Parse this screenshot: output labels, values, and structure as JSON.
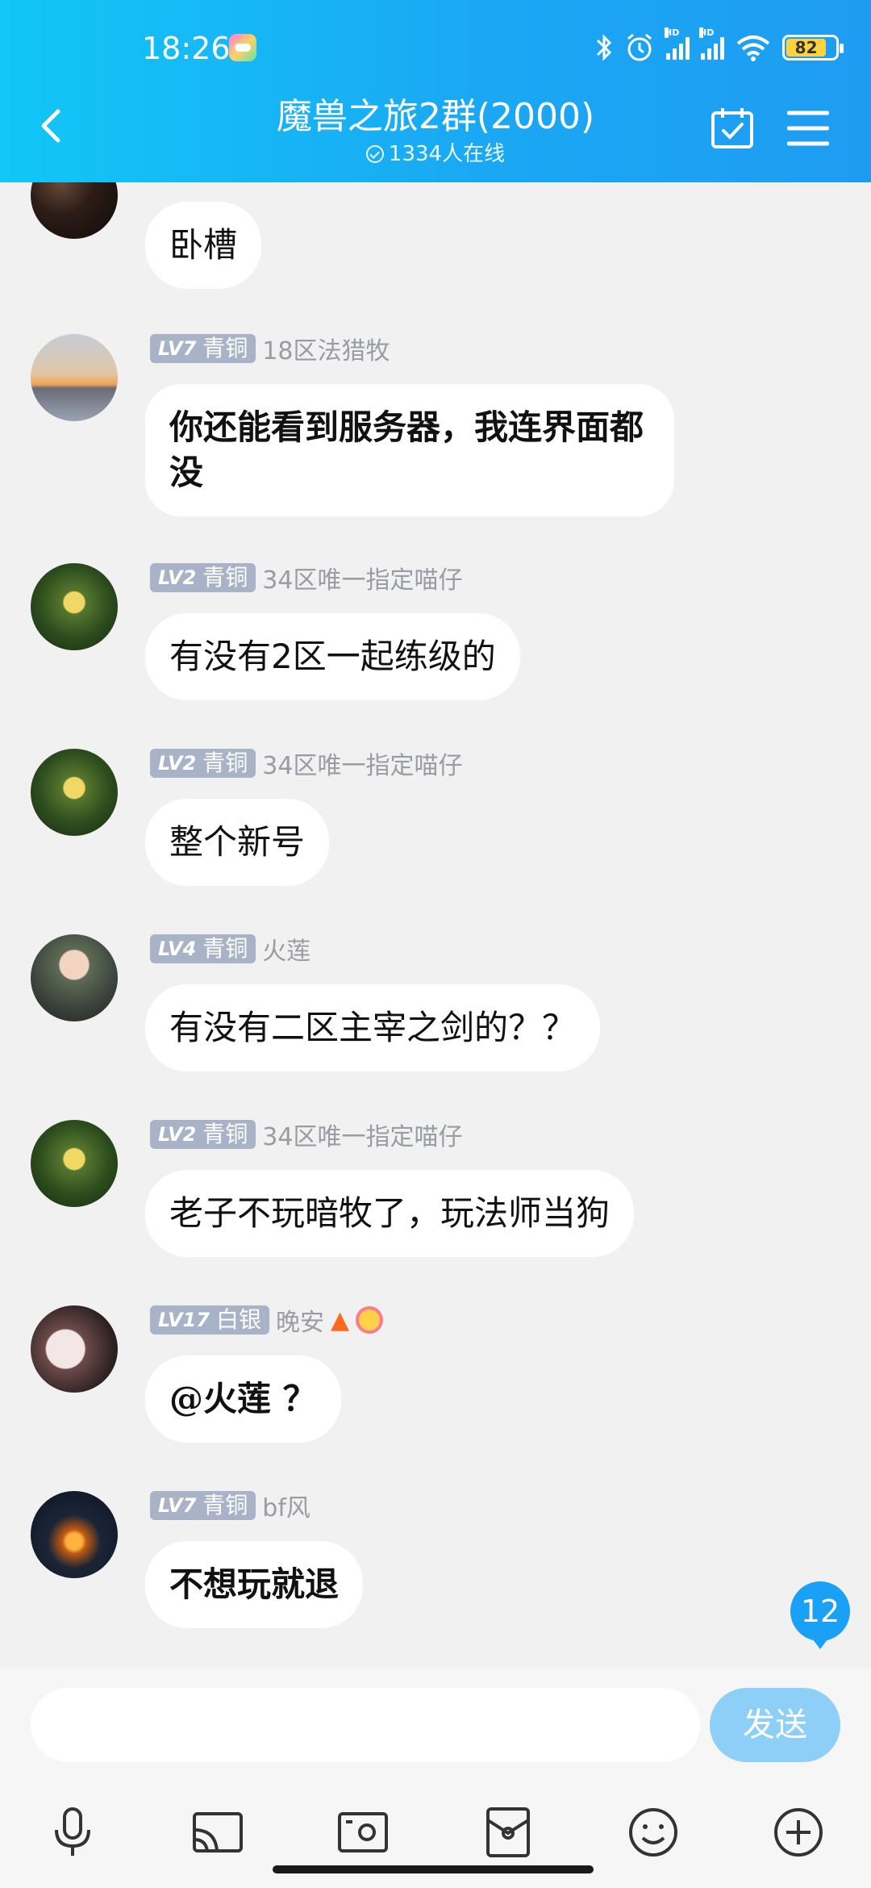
{
  "status_bar": {
    "time": "18:26",
    "battery": "82"
  },
  "header": {
    "title": "魔兽之旅2群(2000)",
    "online": "1334人在线"
  },
  "messages": [
    {
      "level": "",
      "tier": "",
      "name": "",
      "text": "卧槽"
    },
    {
      "level": "LV7",
      "tier": "青铜",
      "name": "18区法猎牧",
      "text": "你还能看到服务器，我连界面都没"
    },
    {
      "level": "LV2",
      "tier": "青铜",
      "name": "34区唯一指定喵仔",
      "text": "有没有2区一起练级的"
    },
    {
      "level": "LV2",
      "tier": "青铜",
      "name": "34区唯一指定喵仔",
      "text": "整个新号"
    },
    {
      "level": "LV4",
      "tier": "青铜",
      "name": "火莲",
      "text": "有没有二区主宰之剑的？？"
    },
    {
      "level": "LV2",
      "tier": "青铜",
      "name": "34区唯一指定喵仔",
      "text": "老子不玩暗牧了，玩法师当狗"
    },
    {
      "level": "LV17",
      "tier": "白银",
      "name": "晚安",
      "text": "@火莲 ？"
    },
    {
      "level": "LV7",
      "tier": "青铜",
      "name": "bf风",
      "text": "不想玩就退"
    }
  ],
  "unread_count": "12",
  "input": {
    "placeholder": "",
    "send_label": "发送"
  },
  "toolbar": [
    "microphone-icon",
    "screen-cast-icon",
    "photo-icon",
    "red-packet-icon",
    "emoji-icon",
    "plus-icon"
  ]
}
